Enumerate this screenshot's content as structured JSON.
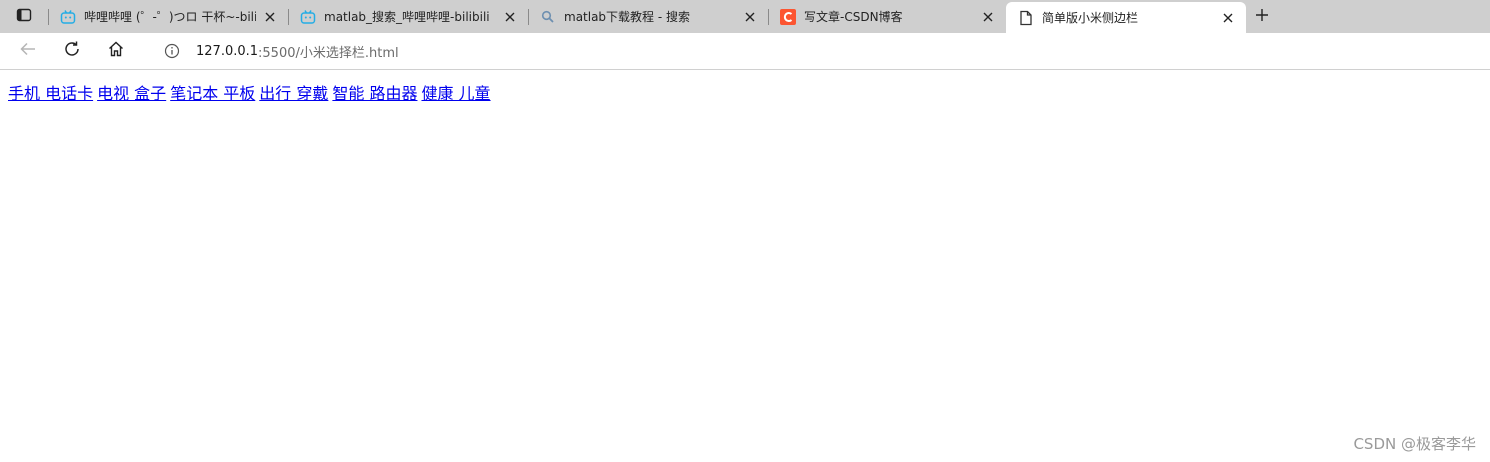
{
  "browser": {
    "tabs": [
      {
        "title": "哔哩哔哩 (゜-゜)つロ 干杯~-bilibili",
        "favicon": "bilibili-icon",
        "active": false
      },
      {
        "title": "matlab_搜索_哔哩哔哩-bilibili",
        "favicon": "bilibili-icon",
        "active": false
      },
      {
        "title": "matlab下载教程 - 搜索",
        "favicon": "search-icon",
        "active": false
      },
      {
        "title": "写文章-CSDN博客",
        "favicon": "csdn-icon",
        "active": false
      },
      {
        "title": "简单版小米侧边栏",
        "favicon": "page-icon",
        "active": true
      }
    ],
    "address": {
      "host": "127.0.0.1",
      "path": ":5500/小米选择栏.html"
    },
    "colors": {
      "tabbar_bg": "#cfcfcf",
      "bilibili": "#23ade5",
      "csdn": "#fc5531",
      "link": "#0000ee"
    }
  },
  "page": {
    "links": [
      "手机 电话卡",
      "电视 盒子",
      "笔记本 平板",
      "出行 穿戴",
      "智能 路由器",
      "健康 儿童"
    ]
  },
  "watermark": "CSDN @极客李华"
}
